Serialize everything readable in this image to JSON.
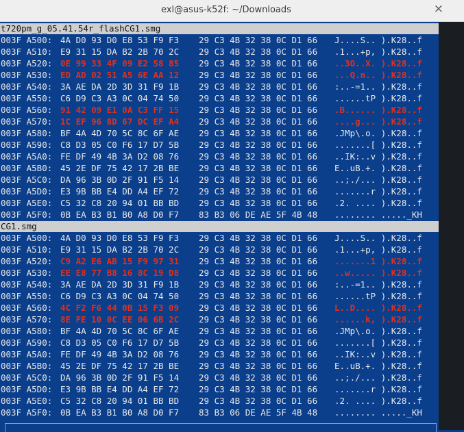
{
  "window": {
    "title": "exl@asus-k52f: ~/Downloads",
    "close_glyph": "×"
  },
  "panels": [
    {
      "filename": "t720pm_g_05.41.54r_flashCG1.smg",
      "rows": [
        {
          "addr": "003F A500:",
          "g1": "4A D0 93 D0 E8 53 F9 F3",
          "g2": "29 C3 4B 32 38 0C D1 66",
          "ascii": "J....S.. ).K28..f",
          "diff": false
        },
        {
          "addr": "003F A510:",
          "g1": "E9 31 15 DA B2 2B 70 2C",
          "g2": "29 C3 4B 32 38 0C D1 66",
          "ascii": ".1...+p, ).K28..f",
          "diff": false
        },
        {
          "addr": "003F A520:",
          "g1": "0E 99 33 4F 09 E2 58 85",
          "g2": "29 C3 4B 32 38 0C D1 66",
          "ascii": "..3O..X. ).K28..f",
          "diff": true
        },
        {
          "addr": "003F A530:",
          "g1": "ED AD 02 51 A5 6E AA 12",
          "g2": "29 C3 4B 32 38 0C D1 66",
          "ascii": "...Q.n.. ).K28..f",
          "diff": true
        },
        {
          "addr": "003F A540:",
          "g1": "3A AE DA 2D 3D 31 F9 1B",
          "g2": "29 C3 4B 32 38 0C D1 66",
          "ascii": ":..-=1.. ).K28..f",
          "diff": false
        },
        {
          "addr": "003F A550:",
          "g1": "C6 D9 C3 A3 0C 04 74 50",
          "g2": "29 C3 4B 32 38 0C D1 66",
          "ascii": "......tP ).K28..f",
          "diff": false
        },
        {
          "addr": "003F A560:",
          "g1": "91 42 09 E1 0A C3 FF 15",
          "g2": "29 C3 4B 32 38 0C D1 66",
          "ascii": ".B...... ).K28..f",
          "diff": true
        },
        {
          "addr": "003F A570:",
          "g1": "1C EF 96 8D 67 DC EF A4",
          "g2": "29 C3 4B 32 38 0C D1 66",
          "ascii": "....g... ).K28..f",
          "diff": true
        },
        {
          "addr": "003F A580:",
          "g1": "BF 4A 4D 70 5C 8C 6F AE",
          "g2": "29 C3 4B 32 38 0C D1 66",
          "ascii": ".JMp\\.o. ).K28..f",
          "diff": false
        },
        {
          "addr": "003F A590:",
          "g1": "C8 D3 05 C0 F6 17 D7 5B",
          "g2": "29 C3 4B 32 38 0C D1 66",
          "ascii": ".......[ ).K28..f",
          "diff": false
        },
        {
          "addr": "003F A5A0:",
          "g1": "FE DF 49 4B 3A D2 08 76",
          "g2": "29 C3 4B 32 38 0C D1 66",
          "ascii": "..IK:..v ).K28..f",
          "diff": false
        },
        {
          "addr": "003F A5B0:",
          "g1": "45 2E DF 75 42 17 2B BE",
          "g2": "29 C3 4B 32 38 0C D1 66",
          "ascii": "E..uB.+. ).K28..f",
          "diff": false
        },
        {
          "addr": "003F A5C0:",
          "g1": "DA 96 3B 0D 2F 91 F5 14",
          "g2": "29 C3 4B 32 38 0C D1 66",
          "ascii": "..;./... ).K28..f",
          "diff": false
        },
        {
          "addr": "003F A5D0:",
          "g1": "E3 9B BB E4 DD A4 EF 72",
          "g2": "29 C3 4B 32 38 0C D1 66",
          "ascii": ".......r ).K28..f",
          "diff": false
        },
        {
          "addr": "003F A5E0:",
          "g1": "C5 32 C8 20 94 01 BB BD",
          "g2": "29 C3 4B 32 38 0C D1 66",
          "ascii": ".2. .... ).K28..f",
          "diff": false
        },
        {
          "addr": "003F A5F0:",
          "g1": "0B EA B3 B1 B0 A8 D0 F7",
          "g2": "83 B3 06 DE AE 5F 4B 48",
          "ascii": "........ ....._KH",
          "diff": false
        }
      ]
    },
    {
      "filename": "CG1.smg",
      "rows": [
        {
          "addr": "003F A500:",
          "g1": "4A D0 93 D0 E8 53 F9 F3",
          "g2": "29 C3 4B 32 38 0C D1 66",
          "ascii": "J....S.. ).K28..f",
          "diff": false
        },
        {
          "addr": "003F A510:",
          "g1": "E9 31 15 DA B2 2B 70 2C",
          "g2": "29 C3 4B 32 38 0C D1 66",
          "ascii": ".1...+p, ).K28..f",
          "diff": false
        },
        {
          "addr": "003F A520:",
          "g1": "C9 A2 E6 AB 15 F9 97 31",
          "g2": "29 C3 4B 32 38 0C D1 66",
          "ascii": ".......1 ).K28..f",
          "diff": true
        },
        {
          "addr": "003F A530:",
          "g1": "EE E8 77 B8 16 8C 19 D8",
          "g2": "29 C3 4B 32 38 0C D1 66",
          "ascii": "..w..... ).K28..f",
          "diff": true
        },
        {
          "addr": "003F A540:",
          "g1": "3A AE DA 2D 3D 31 F9 1B",
          "g2": "29 C3 4B 32 38 0C D1 66",
          "ascii": ":..-=1.. ).K28..f",
          "diff": false
        },
        {
          "addr": "003F A550:",
          "g1": "C6 D9 C3 A3 0C 04 74 50",
          "g2": "29 C3 4B 32 38 0C D1 66",
          "ascii": "......tP ).K28..f",
          "diff": false
        },
        {
          "addr": "003F A560:",
          "g1": "4C F2 F6 44 0B 15 F3 09",
          "g2": "29 C3 4B 32 38 0C D1 66",
          "ascii": "L..D.... ).K28..f",
          "diff": true
        },
        {
          "addr": "003F A570:",
          "g1": "8E FE 10 0C EE 06 6B 2C",
          "g2": "29 C3 4B 32 38 0C D1 66",
          "ascii": "......k, ).K28..f",
          "diff": true
        },
        {
          "addr": "003F A580:",
          "g1": "BF 4A 4D 70 5C 8C 6F AE",
          "g2": "29 C3 4B 32 38 0C D1 66",
          "ascii": ".JMp\\.o. ).K28..f",
          "diff": false
        },
        {
          "addr": "003F A590:",
          "g1": "C8 D3 05 C0 F6 17 D7 5B",
          "g2": "29 C3 4B 32 38 0C D1 66",
          "ascii": ".......[ ).K28..f",
          "diff": false
        },
        {
          "addr": "003F A5A0:",
          "g1": "FE DF 49 4B 3A D2 08 76",
          "g2": "29 C3 4B 32 38 0C D1 66",
          "ascii": "..IK:..v ).K28..f",
          "diff": false
        },
        {
          "addr": "003F A5B0:",
          "g1": "45 2E DF 75 42 17 2B BE",
          "g2": "29 C3 4B 32 38 0C D1 66",
          "ascii": "E..uB.+. ).K28..f",
          "diff": false
        },
        {
          "addr": "003F A5C0:",
          "g1": "DA 96 3B 0D 2F 91 F5 14",
          "g2": "29 C3 4B 32 38 0C D1 66",
          "ascii": "..;./... ).K28..f",
          "diff": false
        },
        {
          "addr": "003F A5D0:",
          "g1": "E3 9B BB E4 DD A4 EF 72",
          "g2": "29 C3 4B 32 38 0C D1 66",
          "ascii": ".......r ).K28..f",
          "diff": false
        },
        {
          "addr": "003F A5E0:",
          "g1": "C5 32 C8 20 94 01 BB BD",
          "g2": "29 C3 4B 32 38 0C D1 66",
          "ascii": ".2. .... ).K28..f",
          "diff": false
        },
        {
          "addr": "003F A5F0:",
          "g1": "0B EA B3 B1 B0 A8 D0 F7",
          "g2": "83 B3 06 DE AE 5F 4B 48",
          "ascii": "........ ....._KH",
          "diff": false
        }
      ]
    }
  ],
  "colors": {
    "background": "#0b3f8c",
    "diff_text": "#e0301e",
    "normal_text": "#e8e8e8",
    "header_bg": "#cfcfcf",
    "titlebar_bg": "#efefef"
  }
}
